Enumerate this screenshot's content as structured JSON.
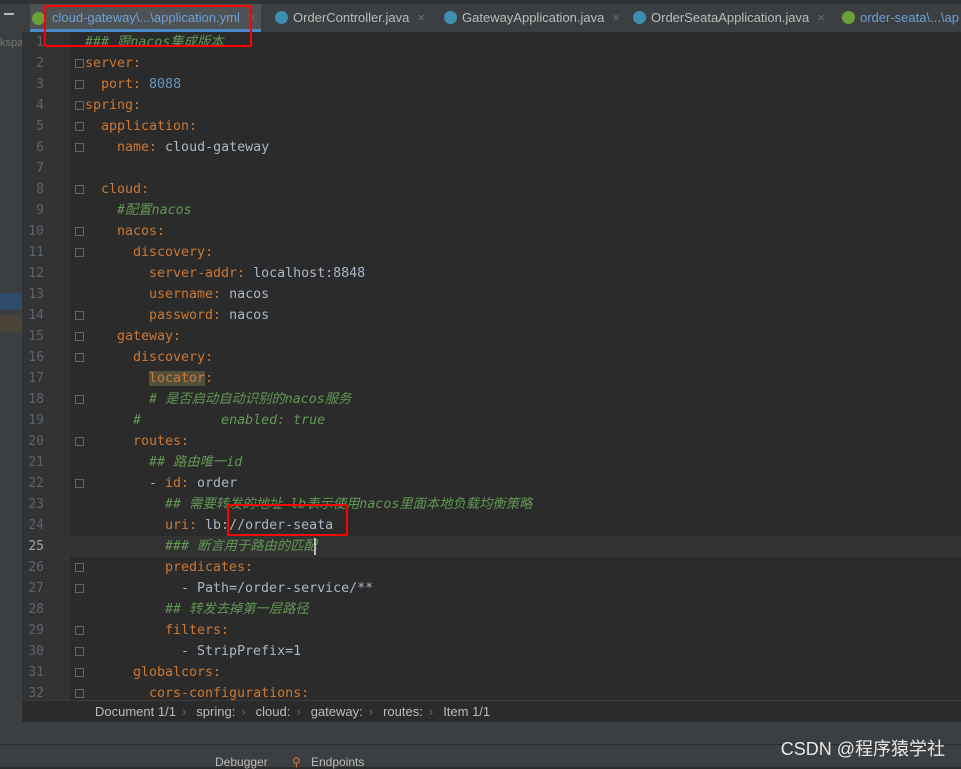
{
  "tabs": [
    {
      "label": "cloud-gateway\\...\\application.yml",
      "icon": "spring-leaf-icon",
      "active": true
    },
    {
      "label": "OrderController.java",
      "icon": "class-icon"
    },
    {
      "label": "GatewayApplication.java",
      "icon": "spring-boot-class-icon"
    },
    {
      "label": "OrderSeataApplication.java",
      "icon": "spring-boot-class-icon"
    },
    {
      "label": "order-seata\\...\\ap",
      "icon": "spring-leaf-icon"
    }
  ],
  "left_panel_label": "kspa",
  "current_line": 25,
  "lines": [
    {
      "indent": 0,
      "seg": [
        [
          "c",
          "### 跟nacos集成版本"
        ]
      ]
    },
    {
      "indent": 0,
      "seg": [
        [
          "k",
          "server"
        ],
        [
          "p",
          ":"
        ]
      ]
    },
    {
      "indent": 2,
      "seg": [
        [
          "k",
          "port"
        ],
        [
          "p",
          ": "
        ],
        [
          "n",
          "8088"
        ]
      ]
    },
    {
      "indent": 0,
      "seg": [
        [
          "k",
          "spring"
        ],
        [
          "p",
          ":"
        ]
      ]
    },
    {
      "indent": 2,
      "seg": [
        [
          "k",
          "application"
        ],
        [
          "p",
          ":"
        ]
      ]
    },
    {
      "indent": 4,
      "seg": [
        [
          "k",
          "name"
        ],
        [
          "p",
          ": "
        ],
        [
          "v",
          "cloud-gateway"
        ]
      ]
    },
    {
      "indent": 0,
      "seg": []
    },
    {
      "indent": 2,
      "seg": [
        [
          "k",
          "cloud"
        ],
        [
          "p",
          ":"
        ]
      ]
    },
    {
      "indent": 4,
      "seg": [
        [
          "c",
          "#配置nacos"
        ]
      ]
    },
    {
      "indent": 4,
      "seg": [
        [
          "k",
          "nacos"
        ],
        [
          "p",
          ":"
        ]
      ]
    },
    {
      "indent": 6,
      "seg": [
        [
          "k",
          "discovery"
        ],
        [
          "p",
          ":"
        ]
      ]
    },
    {
      "indent": 8,
      "seg": [
        [
          "k",
          "server-addr"
        ],
        [
          "p",
          ": "
        ],
        [
          "v",
          "localhost:8848"
        ]
      ]
    },
    {
      "indent": 8,
      "seg": [
        [
          "k",
          "username"
        ],
        [
          "p",
          ": "
        ],
        [
          "v",
          "nacos"
        ]
      ]
    },
    {
      "indent": 8,
      "seg": [
        [
          "k",
          "password"
        ],
        [
          "p",
          ": "
        ],
        [
          "v",
          "nacos"
        ]
      ]
    },
    {
      "indent": 4,
      "seg": [
        [
          "k",
          "gateway"
        ],
        [
          "p",
          ":"
        ]
      ]
    },
    {
      "indent": 6,
      "seg": [
        [
          "k",
          "discovery"
        ],
        [
          "p",
          ":"
        ]
      ]
    },
    {
      "indent": 8,
      "seg": [
        [
          "k hl",
          "locator"
        ],
        [
          "p",
          ":"
        ]
      ]
    },
    {
      "indent": 8,
      "seg": [
        [
          "c",
          "# 是否启动自动识别的nacos服务"
        ]
      ]
    },
    {
      "indent": 6,
      "seg": [
        [
          "c",
          "#          enabled: true"
        ]
      ]
    },
    {
      "indent": 6,
      "seg": [
        [
          "k",
          "routes"
        ],
        [
          "p",
          ":"
        ]
      ]
    },
    {
      "indent": 8,
      "seg": [
        [
          "c",
          "## 路由唯一id"
        ]
      ]
    },
    {
      "indent": 8,
      "seg": [
        [
          "v",
          "- "
        ],
        [
          "k",
          "id"
        ],
        [
          "p",
          ": "
        ],
        [
          "v",
          "order"
        ]
      ]
    },
    {
      "indent": 10,
      "seg": [
        [
          "c",
          "## 需要转发的地址 lb表示使用nacos里面本地负载均衡策略"
        ]
      ]
    },
    {
      "indent": 10,
      "seg": [
        [
          "k",
          "uri"
        ],
        [
          "p",
          ": "
        ],
        [
          "v",
          "lb://order-seata"
        ]
      ]
    },
    {
      "indent": 10,
      "seg": [
        [
          "c",
          "### 断言用于路由的匹配"
        ]
      ]
    },
    {
      "indent": 10,
      "seg": [
        [
          "k",
          "predicates"
        ],
        [
          "p",
          ":"
        ]
      ]
    },
    {
      "indent": 12,
      "seg": [
        [
          "v",
          "- Path=/order-service/**"
        ]
      ]
    },
    {
      "indent": 10,
      "seg": [
        [
          "c",
          "## 转发去掉第一层路径"
        ]
      ]
    },
    {
      "indent": 10,
      "seg": [
        [
          "k",
          "filters"
        ],
        [
          "p",
          ":"
        ]
      ]
    },
    {
      "indent": 12,
      "seg": [
        [
          "v",
          "- StripPrefix=1"
        ]
      ]
    },
    {
      "indent": 6,
      "seg": [
        [
          "k",
          "globalcors"
        ],
        [
          "p",
          ":"
        ]
      ]
    },
    {
      "indent": 8,
      "seg": [
        [
          "k",
          "cors-configurations"
        ],
        [
          "p",
          ":"
        ]
      ]
    }
  ],
  "folds": [
    2,
    3,
    4,
    5,
    6,
    8,
    10,
    11,
    14,
    15,
    16,
    18,
    20,
    22,
    26,
    27,
    29,
    30,
    31,
    32
  ],
  "breadcrumb": [
    "Document 1/1",
    "spring:",
    "cloud:",
    "gateway:",
    "routes:",
    "Item 1/1"
  ],
  "bottom_tools": [
    {
      "label": "Debugger"
    },
    {
      "label": "Endpoints",
      "icon": "endpoints-icon"
    }
  ],
  "watermark": "CSDN @程序猿学社",
  "colors": {
    "key": "#cc7832",
    "value": "#a9b7c6",
    "number": "#6897bb",
    "comment": "#629755",
    "background": "#2b2b2b",
    "annotation": "#ff0000"
  }
}
